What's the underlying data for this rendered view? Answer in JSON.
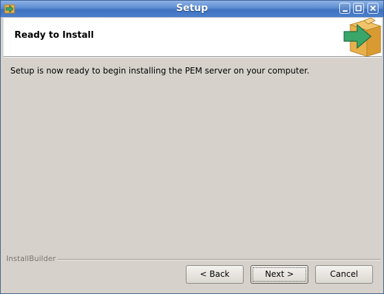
{
  "window": {
    "title": "Setup"
  },
  "icons": {
    "app": "installer-arrow-icon",
    "header": "box-arrow-icon",
    "minimize": "minimize-icon",
    "maximize": "maximize-icon",
    "close": "close-icon"
  },
  "header": {
    "title": "Ready to Install"
  },
  "body": {
    "message": "Setup is now ready to begin installing the PEM server on your computer."
  },
  "footer": {
    "brand": "InstallBuilder",
    "back_label": "< Back",
    "next_label": "Next >",
    "cancel_label": "Cancel"
  },
  "colors": {
    "titlebar": "#4a7fcc",
    "accent_green": "#3aa66a",
    "box": "#e8b04b"
  }
}
